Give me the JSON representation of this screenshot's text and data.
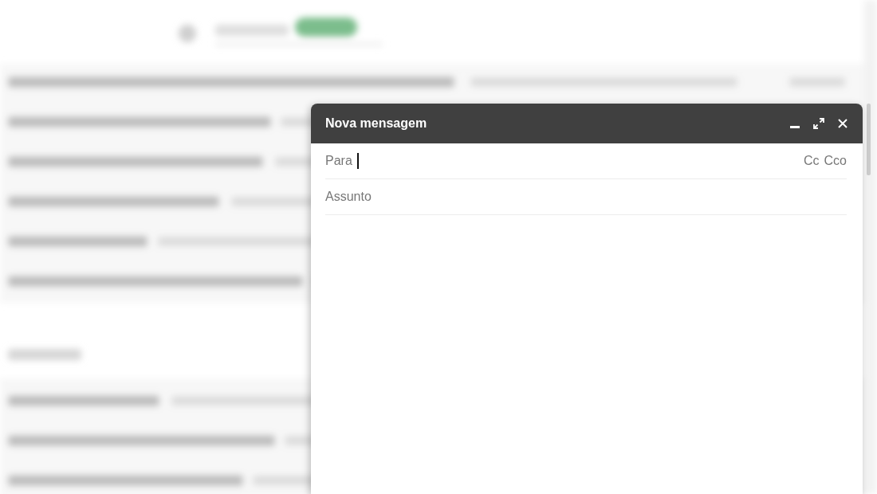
{
  "compose_window": {
    "title": "Nova mensagem",
    "to_field": {
      "label": "Para",
      "focused": true
    },
    "copy_links": [
      "Cc",
      "Cco"
    ],
    "subject_field": {
      "placeholder": "Assunto"
    }
  }
}
